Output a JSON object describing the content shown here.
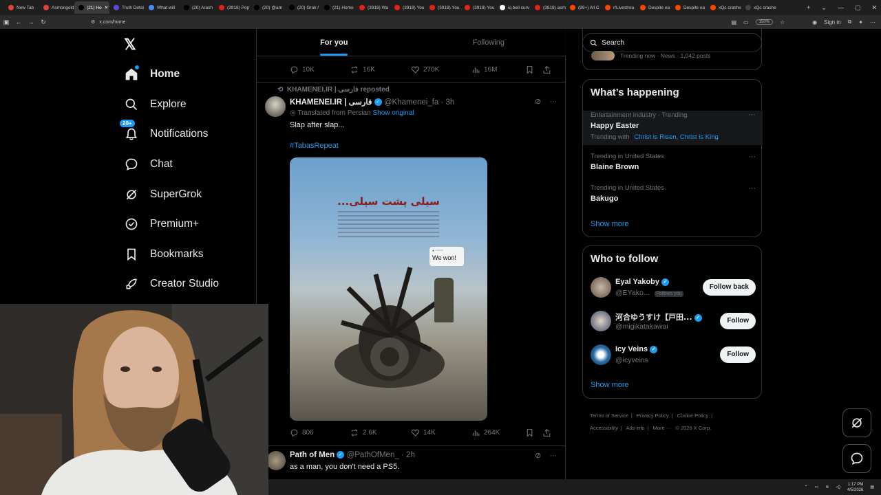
{
  "browser": {
    "tabs": [
      {
        "label": "New Tab",
        "color": "#e34234"
      },
      {
        "label": "Asmongold",
        "color": "#e34234"
      },
      {
        "label": "(21) Ho",
        "color": "#000000",
        "active": true
      },
      {
        "label": "Truth Detai",
        "color": "#5b4bdb"
      },
      {
        "label": "What will",
        "color": "#4c8bf5"
      },
      {
        "label": "(20) Arash",
        "color": "#000000"
      },
      {
        "label": "(3918) Pop",
        "color": "#e62117"
      },
      {
        "label": "(20) @am",
        "color": "#000000"
      },
      {
        "label": "(20) Grok /",
        "color": "#000000"
      },
      {
        "label": "(21) Home",
        "color": "#000000"
      },
      {
        "label": "(3918) Wa",
        "color": "#e62117"
      },
      {
        "label": "(3918) You",
        "color": "#e62117"
      },
      {
        "label": "(3918) You",
        "color": "#e62117"
      },
      {
        "label": "(3918) You",
        "color": "#e62117"
      },
      {
        "label": "iq bell curv",
        "color": "#ffffff"
      },
      {
        "label": "(3918) asm",
        "color": "#e62117"
      },
      {
        "label": "(99+) All C",
        "color": "#ff4500"
      },
      {
        "label": "r/Livestrea",
        "color": "#ff4500"
      },
      {
        "label": "Despite ea",
        "color": "#ff4500"
      },
      {
        "label": "Despite ea",
        "color": "#ff4500"
      },
      {
        "label": "xQc crashe",
        "color": "#ff4500"
      },
      {
        "label": "xQc crashe",
        "color": "#444444"
      }
    ],
    "url": "x.com/home",
    "zoom": "150%",
    "signin": "Sign in"
  },
  "nav": {
    "items": [
      {
        "label": "Home",
        "icon": "home-icon",
        "active": true
      },
      {
        "label": "Explore",
        "icon": "search-icon"
      },
      {
        "label": "Notifications",
        "icon": "bell-icon",
        "badge": "20+"
      },
      {
        "label": "Chat",
        "icon": "chat-bubble-icon"
      },
      {
        "label": "SuperGrok",
        "icon": "grok-icon"
      },
      {
        "label": "Premium+",
        "icon": "verified-badge-icon"
      },
      {
        "label": "Bookmarks",
        "icon": "bookmark-icon"
      },
      {
        "label": "Creator Studio",
        "icon": "rocket-icon"
      }
    ]
  },
  "feed": {
    "tabs": {
      "for_you": "For you",
      "following": "Following"
    },
    "prev_post_stats": {
      "replies": "10K",
      "reposts": "16K",
      "likes": "270K",
      "views": "16M"
    },
    "post1": {
      "reposted_by": "KHAMENEI.IR | فارسی reposted",
      "name": "KHAMENEI.IR | فارسی",
      "handle": "@Khamenei_fa",
      "time": "· 3h",
      "translated": "Translated from Persian",
      "show_original": "Show original",
      "text": "Slap after slap...",
      "hashtag": "#TabasRepeat",
      "image_title": "سیلی پشت سیلی...",
      "image_bubble_text": "We won!",
      "stats": {
        "replies": "806",
        "reposts": "2.6K",
        "likes": "14K",
        "views": "264K"
      }
    },
    "post2": {
      "name": "Path of Men",
      "handle": "@PathOfMen_",
      "time": "· 2h",
      "text": "as a man, you don't need a PS5."
    }
  },
  "sidebar": {
    "search_placeholder": "Search",
    "partial_trend": "Trending now · News · 1,042 posts",
    "happening": {
      "title": "What’s happening",
      "trends": [
        {
          "context": "Entertainment industry · Trending",
          "title": "Happy Easter",
          "with_label": "Trending with",
          "with_links": "Christ is Risen, Christ is King"
        },
        {
          "context": "Trending in United States",
          "title": "Blaine Brown"
        },
        {
          "context": "Trending in United States",
          "title": "Bakugo"
        }
      ],
      "show_more": "Show more"
    },
    "who_to_follow": {
      "title": "Who to follow",
      "accounts": [
        {
          "name": "Eyal Yakoby",
          "handle": "@EYako...",
          "follows_you": "Follows you",
          "button": "Follow back"
        },
        {
          "name": "河合ゆうすけ【戸田...",
          "handle": "@migikatakawai",
          "button": "Follow"
        },
        {
          "name": "Icy Veins",
          "handle": "@icyveins",
          "button": "Follow"
        }
      ],
      "show_more": "Show more"
    },
    "footer": {
      "links": [
        "Terms of Service",
        "Privacy Policy",
        "Cookie Policy",
        "Accessibility",
        "Ads info",
        "More ···",
        "© 2026 X Corp."
      ]
    }
  },
  "taskbar": {
    "time": "1:17 PM",
    "date": "4/5/2026"
  }
}
